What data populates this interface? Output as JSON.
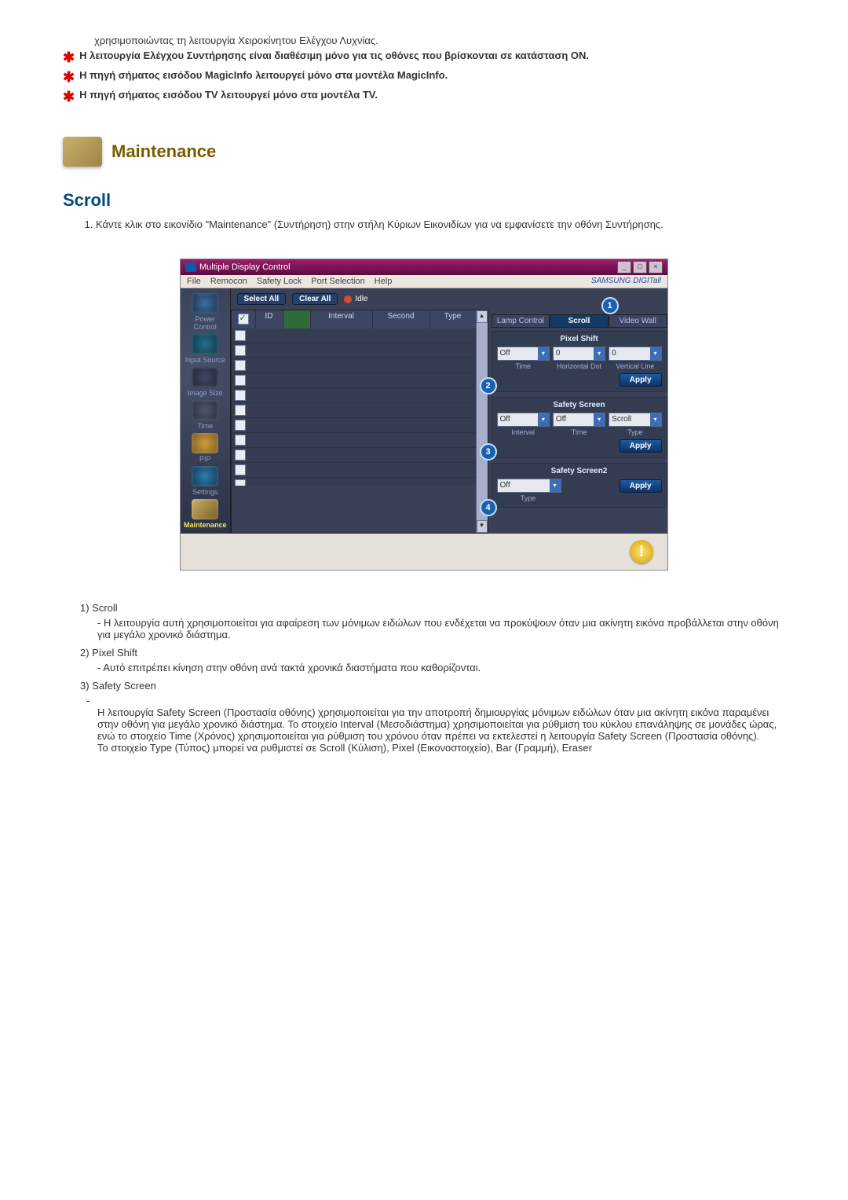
{
  "intro_line": "χρησιμοποιώντας τη λειτουργία Χειροκίνητου Ελέγχου Λυχνίας.",
  "bullets": [
    "Η λειτουργία Ελέγχου Συντήρησης είναι διαθέσιμη μόνο για τις οθόνες που βρίσκονται σε κατάσταση ON.",
    "Η πηγή σήματος εισόδου MagicInfo λειτουργεί μόνο στα μοντέλα MagicInfo.",
    "Η πηγή σήματος εισόδου TV λειτουργεί μόνο στα μοντέλα TV."
  ],
  "section_title": "Maintenance",
  "subsection_title": "Scroll",
  "step1": "Κάντε κλικ στο εικονίδιο \"Maintenance\" (Συντήρηση) στην στήλη Κύριων Εικονιδίων για να εμφανίσετε την οθόνη Συντήρησης.",
  "app": {
    "title": "Multiple Display Control",
    "menu": [
      "File",
      "Remocon",
      "Safety Lock",
      "Port Selection",
      "Help"
    ],
    "brand": "SAMSUNG DIGITall",
    "toolbar": {
      "select_all": "Select All",
      "clear_all": "Clear All",
      "idle": "Idle"
    },
    "sidebar": {
      "power": "Power Control",
      "input": "Input Source",
      "image": "Image Size",
      "time": "Time",
      "pip": "PIP",
      "settings": "Settings",
      "maintenance": "Maintenance"
    },
    "grid": {
      "headers": {
        "id": "ID",
        "interval": "Interval",
        "second": "Second",
        "type": "Type"
      }
    },
    "tabs": {
      "lamp": "Lamp Control",
      "scroll": "Scroll",
      "video": "Video Wall"
    },
    "pixel_shift": {
      "title": "Pixel Shift",
      "off": "Off",
      "v1": "0",
      "v2": "0",
      "labels": [
        "Time",
        "Horizontal Dot",
        "Vertical Line"
      ],
      "apply": "Apply"
    },
    "safety_screen": {
      "title": "Safety Screen",
      "off1": "Off",
      "off2": "Off",
      "scroll": "Scroll",
      "labels": [
        "Interval",
        "Time",
        "Type"
      ],
      "apply": "Apply"
    },
    "safety_screen2": {
      "title": "Safety Screen2",
      "off": "Off",
      "type_label": "Type",
      "apply": "Apply"
    },
    "callouts": {
      "c1": "1",
      "c2": "2",
      "c3": "3",
      "c4": "4"
    }
  },
  "desc": {
    "d1_title": "1)  Scroll",
    "d1_body": "- Η λειτουργία αυτή χρησιμοποιείται για αφαίρεση των μόνιμων ειδώλων που ενδέχεται να προκύψουν όταν μια ακίνητη εικόνα προβάλλεται στην οθόνη για μεγάλο χρονικό διάστημα.",
    "d2_title": "2)  Pixel Shift",
    "d2_body": "- Αυτό επιτρέπει κίνηση στην οθόνη ανά τακτά χρονικά διαστήματα που καθορίζονται.",
    "d3_title": "3)  Safety Screen",
    "d3_dash": "-",
    "d3_body1": "Η λειτουργία Safety Screen (Προστασία οθόνης) χρησιμοποιείται για την αποτροπή δημιουργίας μόνιμων ειδώλων όταν μια ακίνητη εικόνα παραμένει στην οθόνη για μεγάλο χρονικό διάστημα.  Το στοιχείο Interval (Μεσοδιάστημα) χρησιμοποιείται για ρύθμιση του κύκλου επανάληψης σε μονάδες ώρας, ενώ το στοιχείο Time (Χρόνος) χρησιμοποιείται για ρύθμιση του χρόνου όταν πρέπει να εκτελεστεί η λειτουργία Safety Screen (Προστασία οθόνης).",
    "d3_body2": "Το στοιχείο Type (Τύπος) μπορεί να ρυθμιστεί σε Scroll (Κύλιση), Pixel (Εικονοστοιχείο), Bar (Γραμμή), Eraser"
  }
}
